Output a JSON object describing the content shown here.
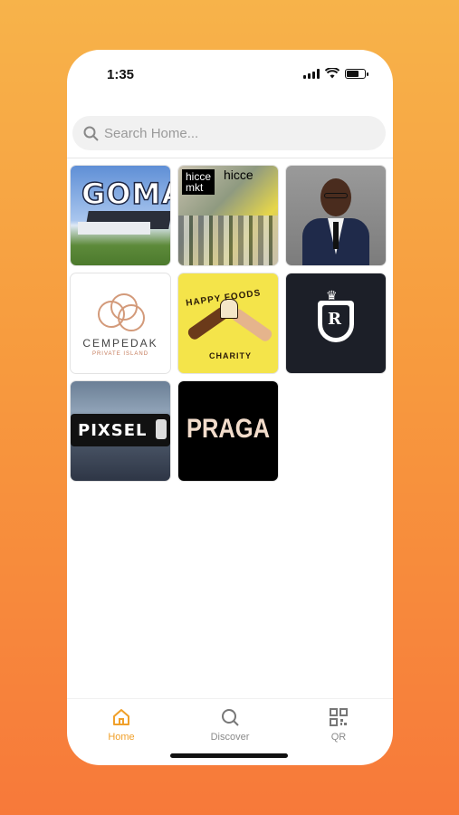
{
  "status_bar": {
    "time": "1:35"
  },
  "search": {
    "placeholder": "Search Home..."
  },
  "tiles": [
    {
      "label": "GOMA"
    },
    {
      "label": "hicce",
      "box_line1": "hicce",
      "box_line2": "mkt"
    },
    {
      "label": ""
    },
    {
      "label": "CEMPEDAK",
      "sub": "PRIVATE ISLAND"
    },
    {
      "label": "HAPPY FOODS",
      "sub": "CHARITY"
    },
    {
      "label": "R"
    },
    {
      "label": "PIXSEL"
    },
    {
      "label": "PRAGA"
    }
  ],
  "tabs": [
    {
      "label": "Home",
      "icon": "home-icon",
      "active": true
    },
    {
      "label": "Discover",
      "icon": "search-icon"
    },
    {
      "label": "QR",
      "icon": "qr-icon"
    }
  ],
  "colors": {
    "accent": "#f0a02a",
    "bg_top": "#f7b34a",
    "bg_bottom": "#f7793a"
  }
}
